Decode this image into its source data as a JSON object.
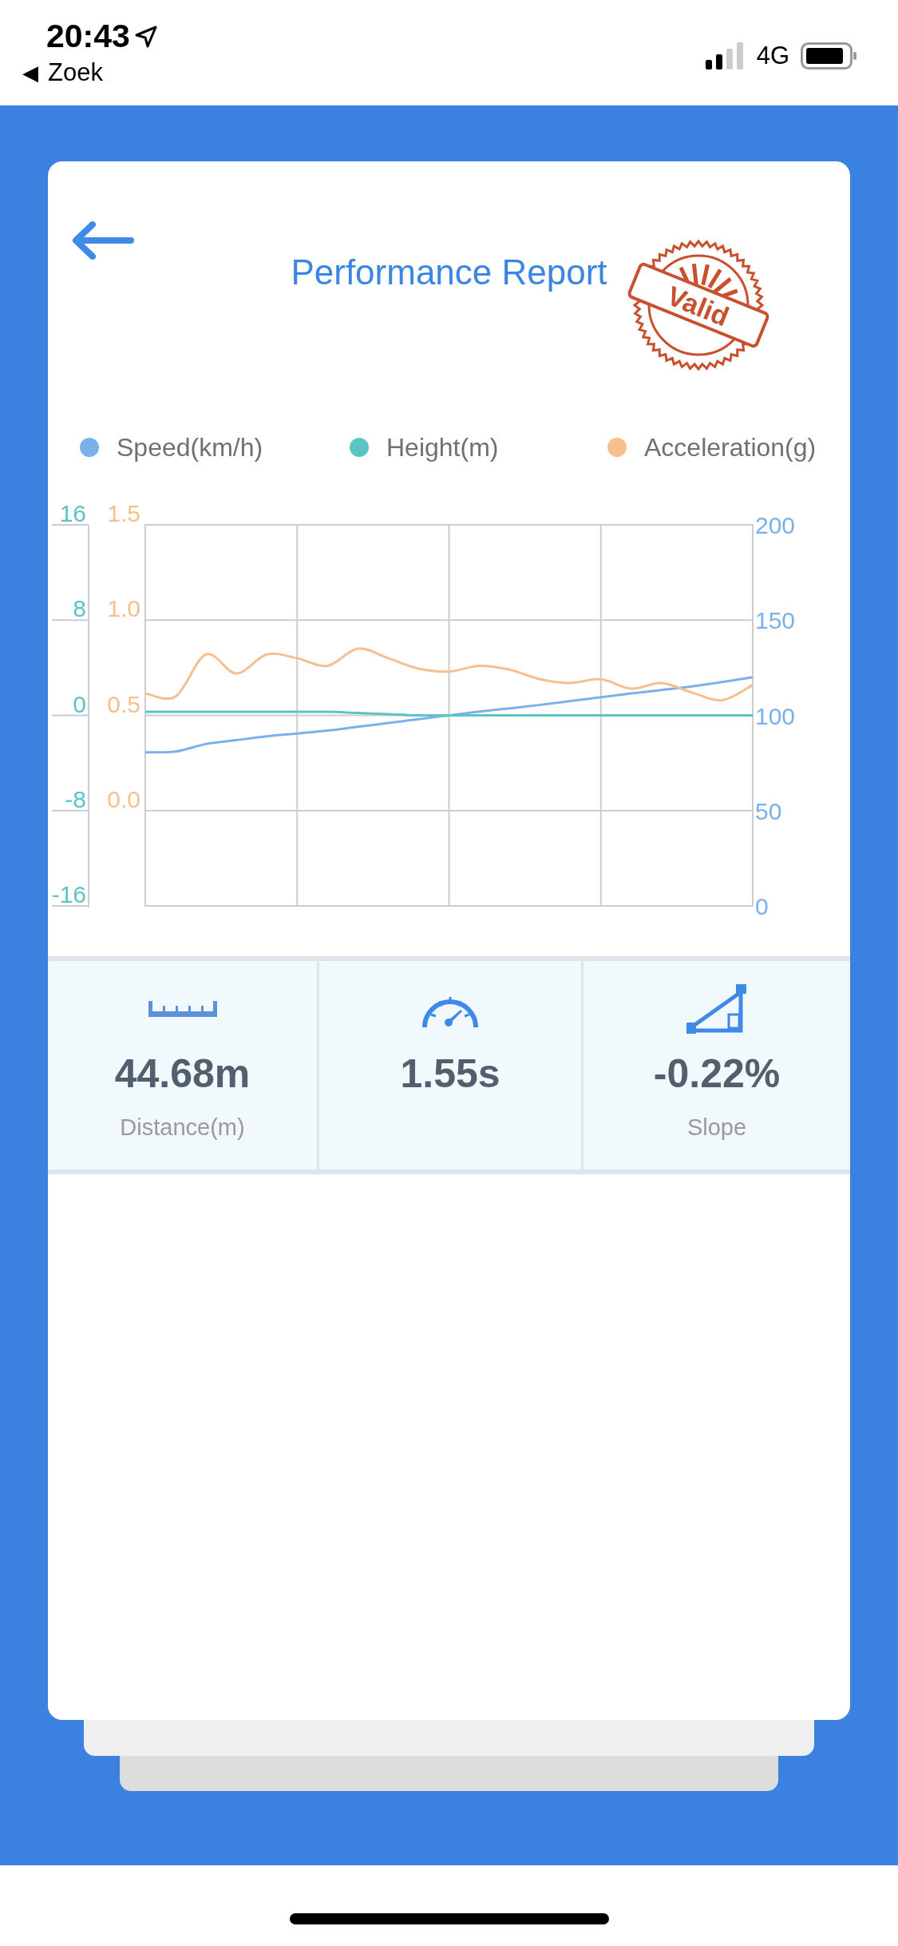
{
  "status_bar": {
    "time": "20:43",
    "back_glyph": "◀",
    "back_label": "Zoek",
    "network": "4G"
  },
  "header": {
    "title": "Performance Report",
    "stamp": "Valid"
  },
  "chart": {
    "chart_data": {
      "type": "line",
      "grid": true,
      "ylim": [
        -16,
        16
      ],
      "yticks": [
        16,
        8,
        0,
        -8,
        -16
      ],
      "y2lim": [
        -0.5,
        1.5
      ],
      "y2ticks": [
        {
          "value": 1.5,
          "label": "1.5"
        },
        {
          "value": 1,
          "label": "1.0"
        },
        {
          "value": 0.5,
          "label": "0.5"
        },
        {
          "value": 0,
          "label": "0.0"
        }
      ],
      "y3lim": [
        0,
        200
      ],
      "y3ticks": [
        200,
        150,
        100,
        50,
        0
      ],
      "series": [
        {
          "name": "Speed(km/h)",
          "color": "#7ab1ec",
          "axis": "y3",
          "values": [
            80.6,
            81,
            85,
            87,
            89,
            90.5,
            92,
            94,
            96,
            98,
            100,
            102,
            103.7,
            105.5,
            107.5,
            109.5,
            111.5,
            113.3,
            115.2,
            117.5,
            120
          ]
        },
        {
          "name": "Height(m)",
          "color": "#5dc4c4",
          "values": [
            0.3,
            0.3,
            0.3,
            0.3,
            0.3,
            0.3,
            0.3,
            0.2,
            0.1,
            0,
            0,
            0,
            0,
            0,
            0,
            0,
            0,
            0,
            0,
            0,
            0
          ]
        },
        {
          "name": "Acceleration(g)",
          "color": "#f5bf8e",
          "axis": "y2",
          "values": [
            0.615,
            0.6,
            0.82,
            0.72,
            0.82,
            0.8,
            0.76,
            0.85,
            0.8,
            0.745,
            0.73,
            0.76,
            0.74,
            0.69,
            0.67,
            0.69,
            0.64,
            0.67,
            0.62,
            0.58,
            0.66
          ]
        }
      ]
    }
  },
  "stats": [
    {
      "kind": "distance",
      "value": "44.68m",
      "label": "Distance(m)"
    },
    {
      "kind": "time",
      "value": "1.55s"
    },
    {
      "kind": "slope",
      "value": "-0.22%",
      "label": "Slope"
    }
  ]
}
